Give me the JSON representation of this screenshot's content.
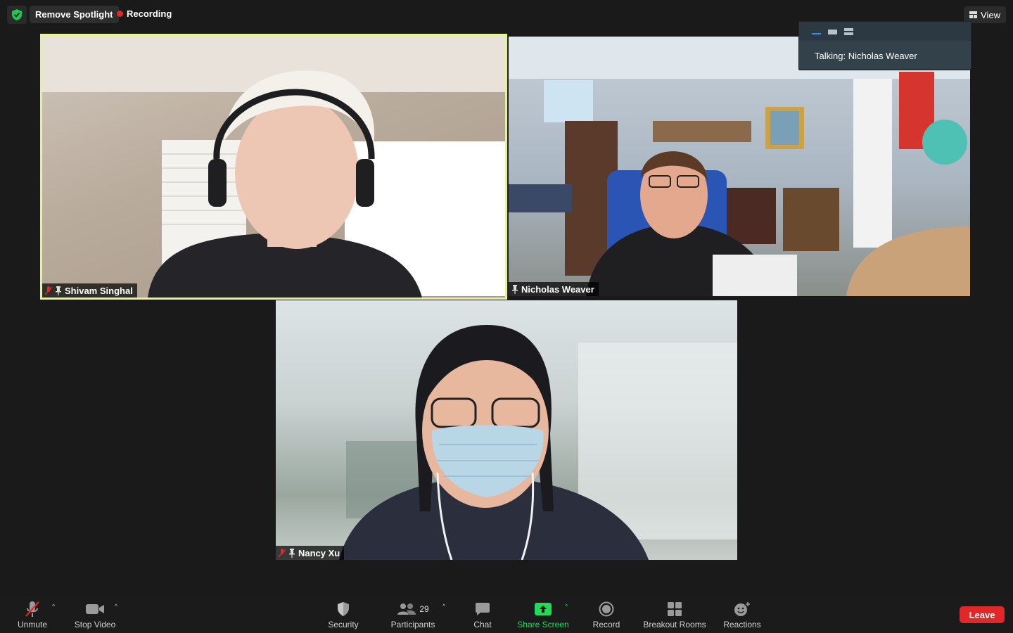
{
  "topbar": {
    "remove_spotlight": "Remove Spotlight",
    "recording": "Recording",
    "view": "View"
  },
  "view_menu": {
    "talking": "Talking: Nicholas Weaver"
  },
  "participants": [
    {
      "name": "Shivam Singhal",
      "muted": true,
      "pinned": true,
      "active": true
    },
    {
      "name": "Nicholas Weaver",
      "muted": false,
      "pinned": true,
      "active": false
    },
    {
      "name": "Nancy Xu",
      "muted": true,
      "pinned": true,
      "active": false
    }
  ],
  "toolbar": {
    "unmute": "Unmute",
    "stop_video": "Stop Video",
    "security": "Security",
    "participants": "Participants",
    "participants_count": "29",
    "chat": "Chat",
    "share_screen": "Share Screen",
    "record": "Record",
    "breakout_rooms": "Breakout Rooms",
    "reactions": "Reactions",
    "leave": "Leave"
  },
  "colors": {
    "spotlight_border": "#e4f29a",
    "share_green": "#23d959",
    "leave_red": "#e02828",
    "recording_red": "#e02828"
  }
}
